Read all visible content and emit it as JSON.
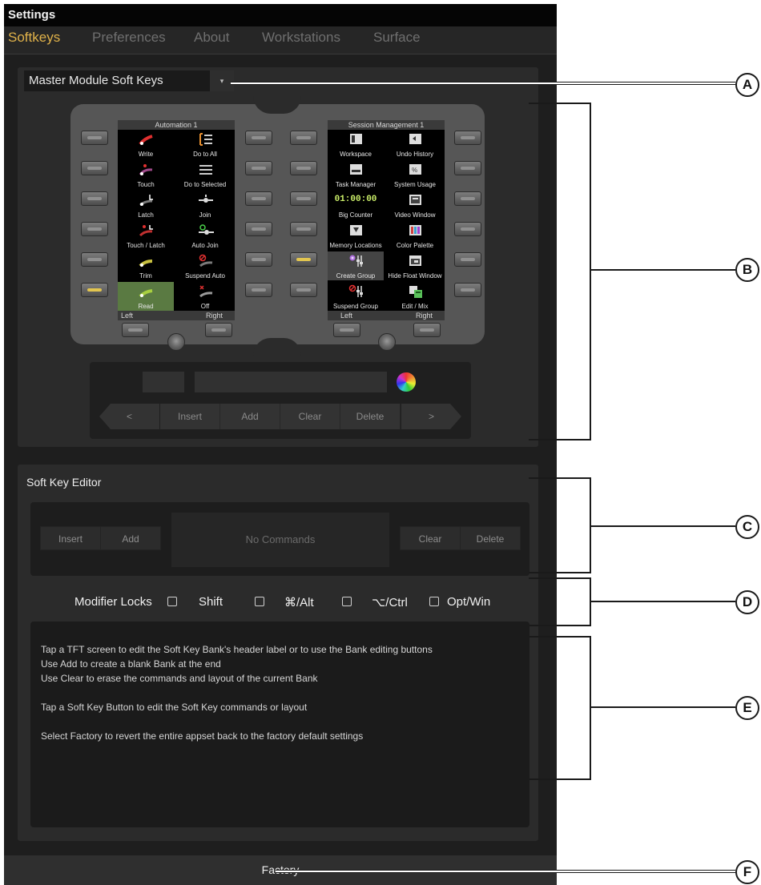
{
  "window": {
    "title": "Settings"
  },
  "tabs": [
    {
      "label": "Softkeys",
      "active": true
    },
    {
      "label": "Preferences"
    },
    {
      "label": "About"
    },
    {
      "label": "Workstations"
    },
    {
      "label": "Surface"
    }
  ],
  "bank_selector": {
    "value": "Master Module Soft Keys",
    "caret": "▾"
  },
  "screens": {
    "left": {
      "header": "Automation 1",
      "footer_left": "Left",
      "footer_right": "Right",
      "cells": [
        {
          "label": "Write",
          "icon": "write-icon"
        },
        {
          "label": "Do to All",
          "icon": "do-to-all-icon"
        },
        {
          "label": "Touch",
          "icon": "touch-icon"
        },
        {
          "label": "Do to Selected",
          "icon": "do-to-selected-icon"
        },
        {
          "label": "Latch",
          "icon": "latch-icon"
        },
        {
          "label": "Join",
          "icon": "join-icon"
        },
        {
          "label": "Touch / Latch",
          "icon": "touch-latch-icon"
        },
        {
          "label": "Auto Join",
          "icon": "auto-join-icon"
        },
        {
          "label": "Trim",
          "icon": "trim-icon"
        },
        {
          "label": "Suspend Auto",
          "icon": "suspend-auto-icon"
        },
        {
          "label": "Read",
          "icon": "read-icon"
        },
        {
          "label": "Off",
          "icon": "off-icon"
        }
      ]
    },
    "right": {
      "header": "Session Management 1",
      "footer_left": "Left",
      "footer_right": "Right",
      "big_counter_value": "01:00:00",
      "cells": [
        {
          "label": "Workspace",
          "icon": "workspace-icon"
        },
        {
          "label": "Undo History",
          "icon": "undo-history-icon"
        },
        {
          "label": "Task Manager",
          "icon": "task-manager-icon"
        },
        {
          "label": "System Usage",
          "icon": "system-usage-icon"
        },
        {
          "label": "Big Counter",
          "icon": "big-counter-icon"
        },
        {
          "label": "Video Window",
          "icon": "video-window-icon"
        },
        {
          "label": "Memory Locations",
          "icon": "memory-locations-icon"
        },
        {
          "label": "Color Palette",
          "icon": "color-palette-icon"
        },
        {
          "label": "Create Group",
          "icon": "create-group-icon"
        },
        {
          "label": "Hide Float Window",
          "icon": "hide-float-window-icon"
        },
        {
          "label": "Suspend Group",
          "icon": "suspend-group-icon"
        },
        {
          "label": "Edit / Mix",
          "icon": "edit-mix-icon"
        }
      ]
    }
  },
  "bank_controls": {
    "prev": "<",
    "insert": "Insert",
    "add": "Add",
    "clear": "Clear",
    "delete": "Delete",
    "next": ">"
  },
  "editor": {
    "title": "Soft Key Editor",
    "insert": "Insert",
    "add": "Add",
    "commands_placeholder": "No Commands",
    "clear": "Clear",
    "delete": "Delete"
  },
  "modifiers": {
    "label": "Modifier Locks",
    "items": [
      {
        "label": "Shift",
        "checked": false
      },
      {
        "label": "⌘/Alt",
        "checked": false
      },
      {
        "label": "⌥/Ctrl",
        "checked": false
      },
      {
        "label": "Opt/Win",
        "checked": false
      }
    ]
  },
  "info": {
    "lines": [
      "Tap a TFT screen to edit the Soft Key Bank's header label or to use the Bank editing buttons",
      "Use Add to create a blank Bank at the end",
      "Use Clear to erase the commands and layout of the current Bank",
      "Tap a Soft Key Button to edit the Soft Key commands or layout",
      "Select Factory to revert the entire appset back to the factory default settings"
    ]
  },
  "factory": {
    "label": "Factory"
  },
  "callouts": [
    "A",
    "B",
    "C",
    "D",
    "E",
    "F"
  ],
  "colors": {
    "accent": "#e0b24a",
    "soft_key_lit": "#e2c54f",
    "big_counter": "#ccf06a",
    "selected_cell": "#5a7a42"
  }
}
